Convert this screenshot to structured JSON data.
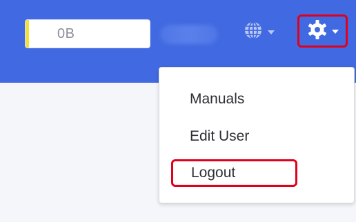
{
  "header": {
    "quota": {
      "value": "0B",
      "used_fraction": 0.03
    },
    "language_button": {
      "icon": "globe-icon",
      "caret_icon": "chevron-down-icon"
    },
    "settings_button": {
      "icon": "gear-icon",
      "caret_icon": "chevron-down-icon",
      "highlighted": true
    }
  },
  "settings_menu": {
    "items": [
      {
        "label": "Manuals"
      },
      {
        "label": "Edit User"
      },
      {
        "label": "Logout",
        "highlighted": true
      }
    ]
  },
  "colors": {
    "header_background": "#4169e1",
    "highlight_outline": "#e0001a",
    "quota_indicator": "#f1e13a",
    "page_background": "#f4f6fa"
  }
}
